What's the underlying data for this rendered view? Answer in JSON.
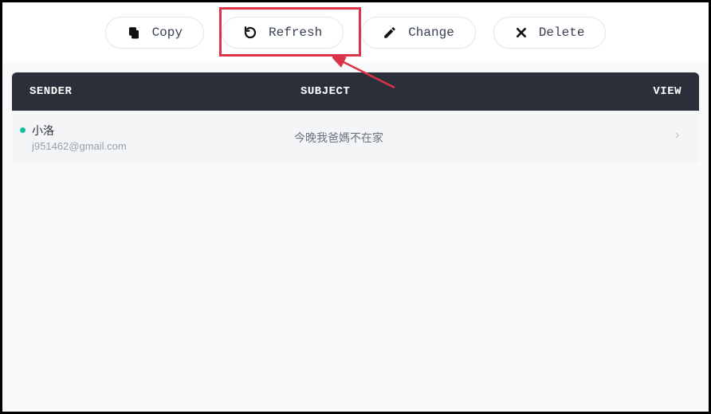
{
  "toolbar": {
    "copy_label": "Copy",
    "refresh_label": "Refresh",
    "change_label": "Change",
    "delete_label": "Delete"
  },
  "table": {
    "headers": {
      "sender": "SENDER",
      "subject": "SUBJECT",
      "view": "VIEW"
    },
    "rows": [
      {
        "sender_name": "小洛",
        "sender_email": "j951462@gmail.com",
        "subject": "今晚我爸媽不在家"
      }
    ]
  },
  "annotation": {
    "highlight_target": "refresh-button"
  }
}
